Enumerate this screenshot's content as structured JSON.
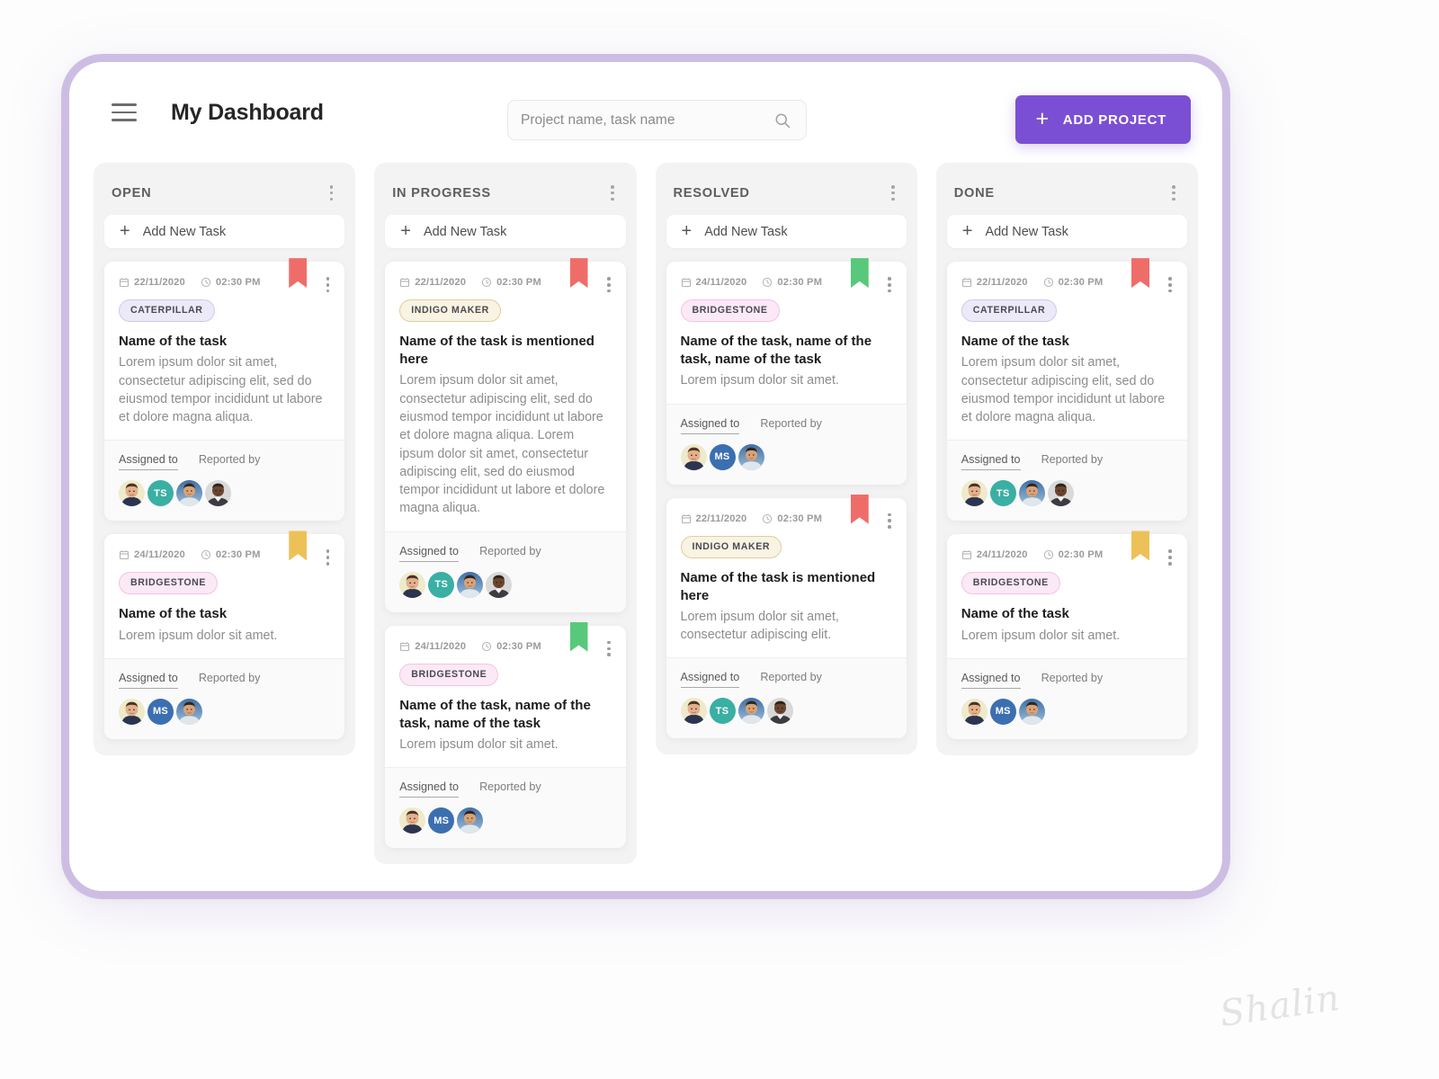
{
  "header": {
    "title": "My Dashboard",
    "menu_icon": "hamburger-icon",
    "search": {
      "placeholder": "Project name, task name",
      "value": "",
      "icon": "search-icon"
    },
    "add_project_label": "ADD PROJECT",
    "add_project_icon": "plus-icon",
    "accent_color": "#7b4fd4"
  },
  "colors": {
    "flag_red": "#ef6d69",
    "flag_green": "#58c97a",
    "flag_yellow": "#eec158",
    "avatar_teal": "#3aafa3",
    "avatar_blue": "#3b6fb0",
    "column_bg": "#f3f3f4",
    "frame_border": "#cdbde3"
  },
  "board": {
    "add_task_label": "Add New Task",
    "assigned_tab": "Assigned to",
    "reported_tab": "Reported by",
    "columns": [
      {
        "title": "OPEN",
        "cards": [
          {
            "date": "22/11/2020",
            "time": "02:30 PM",
            "flag": "red",
            "tag": "CATERPILLAR",
            "tag_style": "caterpillar",
            "title": "Name of the task",
            "desc": "Lorem ipsum dolor sit amet, consectetur adipiscing elit, sed do eiusmod tempor incididunt ut labore et dolore magna aliqua.",
            "avatars": [
              "photo-1",
              "TS",
              "photo-2",
              "photo-3"
            ]
          },
          {
            "date": "24/11/2020",
            "time": "02:30 PM",
            "flag": "yellow",
            "tag": "BRIDGESTONE",
            "tag_style": "bridgestone",
            "title": "Name of the task",
            "desc": "Lorem ipsum dolor sit amet.",
            "avatars": [
              "photo-1",
              "MS",
              "photo-2"
            ]
          }
        ]
      },
      {
        "title": "IN PROGRESS",
        "cards": [
          {
            "date": "22/11/2020",
            "time": "02:30 PM",
            "flag": "red",
            "tag": "INDIGO MAKER",
            "tag_style": "indigo",
            "title": "Name of the task is mentioned here",
            "desc": "Lorem ipsum dolor sit amet, consectetur adipiscing elit, sed do eiusmod tempor incididunt ut labore et dolore magna aliqua. Lorem ipsum dolor sit amet, consectetur adipiscing elit, sed do eiusmod tempor incididunt ut labore et dolore magna aliqua.",
            "avatars": [
              "photo-1",
              "TS",
              "photo-2",
              "photo-3"
            ]
          },
          {
            "date": "24/11/2020",
            "time": "02:30 PM",
            "flag": "green",
            "tag": "BRIDGESTONE",
            "tag_style": "bridgestone",
            "title": "Name of the task, name of the task, name of the task",
            "desc": "Lorem ipsum dolor sit amet.",
            "avatars": [
              "photo-1",
              "MS",
              "photo-2"
            ]
          }
        ]
      },
      {
        "title": "RESOLVED",
        "cards": [
          {
            "date": "24/11/2020",
            "time": "02:30 PM",
            "flag": "green",
            "tag": "BRIDGESTONE",
            "tag_style": "bridgestone",
            "title": "Name of the task, name of the task, name of the task",
            "desc": "Lorem ipsum dolor sit amet.",
            "avatars": [
              "photo-1",
              "MS",
              "photo-2"
            ]
          },
          {
            "date": "22/11/2020",
            "time": "02:30 PM",
            "flag": "red",
            "tag": "INDIGO MAKER",
            "tag_style": "indigo",
            "title": "Name of the task is mentioned here",
            "desc": "Lorem ipsum dolor sit amet, consectetur adipiscing elit.",
            "avatars": [
              "photo-1",
              "TS",
              "photo-2",
              "photo-3"
            ]
          }
        ]
      },
      {
        "title": "DONE",
        "cards": [
          {
            "date": "22/11/2020",
            "time": "02:30 PM",
            "flag": "red",
            "tag": "CATERPILLAR",
            "tag_style": "caterpillar",
            "title": "Name of the task",
            "desc": "Lorem ipsum dolor sit amet, consectetur adipiscing elit, sed do eiusmod tempor incididunt ut labore et dolore magna aliqua.",
            "avatars": [
              "photo-1",
              "TS",
              "photo-2",
              "photo-3"
            ]
          },
          {
            "date": "24/11/2020",
            "time": "02:30 PM",
            "flag": "yellow",
            "tag": "BRIDGESTONE",
            "tag_style": "bridgestone",
            "title": "Name of the task",
            "desc": "Lorem ipsum dolor sit amet.",
            "avatars": [
              "photo-1",
              "MS",
              "photo-2"
            ]
          }
        ]
      }
    ]
  },
  "watermark": "Shalin"
}
